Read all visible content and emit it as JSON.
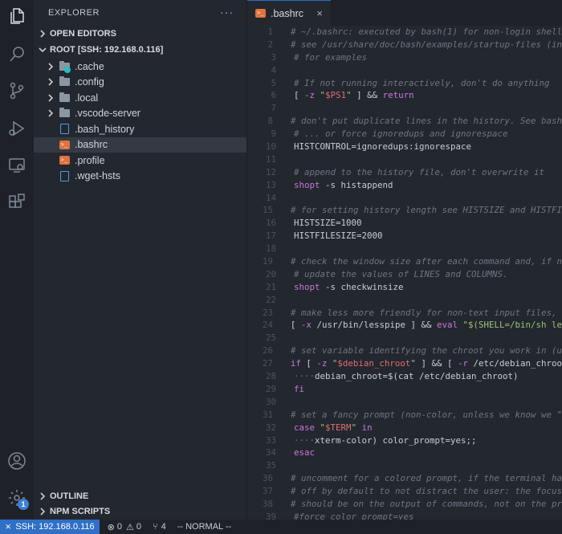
{
  "sidebar": {
    "title": "EXPLORER",
    "more": "···",
    "open_editors": "OPEN EDITORS",
    "root": "ROOT [SSH: 192.168.0.116]",
    "items": [
      {
        "label": ".cache",
        "type": "folder"
      },
      {
        "label": ".config",
        "type": "folder"
      },
      {
        "label": ".local",
        "type": "folder"
      },
      {
        "label": ".vscode-server",
        "type": "folder"
      },
      {
        "label": ".bash_history",
        "type": "file"
      },
      {
        "label": ".bashrc",
        "type": "shell"
      },
      {
        "label": ".profile",
        "type": "shell"
      },
      {
        "label": ".wget-hsts",
        "type": "file"
      }
    ],
    "outline": "OUTLINE",
    "npm_scripts": "NPM SCRIPTS"
  },
  "activity": {
    "icons": [
      "files-icon",
      "search-icon",
      "source-control-icon",
      "run-debug-icon",
      "remote-explorer-icon",
      "extensions-icon",
      "account-icon",
      "settings-gear-icon"
    ],
    "settings_badge": "1"
  },
  "tab": {
    "label": ".bashrc",
    "close": "×"
  },
  "statusbar": {
    "remote": "SSH: 192.168.0.116",
    "errors": "0",
    "warnings": "0",
    "ports": "4",
    "mode": "-- NORMAL --"
  },
  "colors": {
    "accent": "#2f6fc5",
    "comment": "#6d7683",
    "keyword": "#c678dd",
    "string": "#98c379",
    "variable": "#e06c75"
  },
  "code": [
    {
      "n": "1",
      "t": [
        [
          "c",
          "# ~/.bashrc: executed by bash(1) for non-login shell"
        ]
      ]
    },
    {
      "n": "2",
      "t": [
        [
          "c",
          "# see /usr/share/doc/bash/examples/startup-files (in"
        ]
      ]
    },
    {
      "n": "3",
      "t": [
        [
          "c",
          "# for examples"
        ]
      ]
    },
    {
      "n": "4",
      "t": []
    },
    {
      "n": "5",
      "t": [
        [
          "c",
          "# If not running interactively, don't do anything"
        ]
      ]
    },
    {
      "n": "6",
      "t": [
        [
          "p",
          "[ "
        ],
        [
          "k",
          "-z"
        ],
        [
          "p",
          " "
        ],
        [
          "s",
          "\""
        ],
        [
          "v",
          "$PS1"
        ],
        [
          "s",
          "\""
        ],
        [
          "p",
          " ] && "
        ],
        [
          "k",
          "return"
        ]
      ]
    },
    {
      "n": "7",
      "t": []
    },
    {
      "n": "8",
      "t": [
        [
          "c",
          "# don't put duplicate lines in the history. See bash"
        ]
      ]
    },
    {
      "n": "9",
      "t": [
        [
          "c",
          "# ... or force ignoredups and ignorespace"
        ]
      ]
    },
    {
      "n": "10",
      "t": [
        [
          "p",
          "HISTCONTROL=ignoredups:ignorespace"
        ]
      ]
    },
    {
      "n": "11",
      "t": []
    },
    {
      "n": "12",
      "t": [
        [
          "c",
          "# append to the history file, don't overwrite it"
        ]
      ]
    },
    {
      "n": "13",
      "t": [
        [
          "k",
          "shopt"
        ],
        [
          "p",
          " -s histappend"
        ]
      ]
    },
    {
      "n": "14",
      "t": []
    },
    {
      "n": "15",
      "t": [
        [
          "c",
          "# for setting history length see HISTSIZE and HISTFI"
        ]
      ]
    },
    {
      "n": "16",
      "t": [
        [
          "p",
          "HISTSIZE=1000"
        ]
      ]
    },
    {
      "n": "17",
      "t": [
        [
          "p",
          "HISTFILESIZE=2000"
        ]
      ]
    },
    {
      "n": "18",
      "t": []
    },
    {
      "n": "19",
      "t": [
        [
          "c",
          "# check the window size after each command and, if n"
        ]
      ]
    },
    {
      "n": "20",
      "t": [
        [
          "c",
          "# update the values of LINES and COLUMNS."
        ]
      ]
    },
    {
      "n": "21",
      "t": [
        [
          "k",
          "shopt"
        ],
        [
          "p",
          " -s checkwinsize"
        ]
      ]
    },
    {
      "n": "22",
      "t": []
    },
    {
      "n": "23",
      "t": [
        [
          "c",
          "# make less more friendly for non-text input files, "
        ]
      ]
    },
    {
      "n": "24",
      "t": [
        [
          "p",
          "[ "
        ],
        [
          "k",
          "-x"
        ],
        [
          "p",
          " /usr/bin/lesspipe ] && "
        ],
        [
          "k",
          "eval"
        ],
        [
          "p",
          " "
        ],
        [
          "s",
          "\"$(SHELL=/bin/sh le"
        ]
      ]
    },
    {
      "n": "25",
      "t": []
    },
    {
      "n": "26",
      "t": [
        [
          "c",
          "# set variable identifying the chroot you work in (u"
        ]
      ]
    },
    {
      "n": "27",
      "t": [
        [
          "k",
          "if"
        ],
        [
          "p",
          " [ "
        ],
        [
          "k",
          "-z"
        ],
        [
          "p",
          " "
        ],
        [
          "s",
          "\""
        ],
        [
          "v",
          "$debian_chroot"
        ],
        [
          "s",
          "\""
        ],
        [
          "p",
          " ] && [ "
        ],
        [
          "k",
          "-r"
        ],
        [
          "p",
          " /etc/debian_chroo"
        ]
      ]
    },
    {
      "n": "28",
      "t": [
        [
          "c",
          "····"
        ],
        [
          "p",
          "debian_chroot=$(cat /etc/debian_chroot)"
        ]
      ]
    },
    {
      "n": "29",
      "t": [
        [
          "k",
          "fi"
        ]
      ]
    },
    {
      "n": "30",
      "t": []
    },
    {
      "n": "31",
      "t": [
        [
          "c",
          "# set a fancy prompt (non-color, unless we know we \""
        ]
      ]
    },
    {
      "n": "32",
      "t": [
        [
          "k",
          "case"
        ],
        [
          "p",
          " "
        ],
        [
          "s",
          "\""
        ],
        [
          "v",
          "$TERM"
        ],
        [
          "s",
          "\""
        ],
        [
          "p",
          " "
        ],
        [
          "k",
          "in"
        ]
      ]
    },
    {
      "n": "33",
      "t": [
        [
          "c",
          "····"
        ],
        [
          "p",
          "xterm-color) color_prompt=yes;;"
        ]
      ]
    },
    {
      "n": "34",
      "t": [
        [
          "k",
          "esac"
        ]
      ]
    },
    {
      "n": "35",
      "t": []
    },
    {
      "n": "36",
      "t": [
        [
          "c",
          "# uncomment for a colored prompt, if the terminal ha"
        ]
      ]
    },
    {
      "n": "37",
      "t": [
        [
          "c",
          "# off by default to not distract the user: the focus"
        ]
      ]
    },
    {
      "n": "38",
      "t": [
        [
          "c",
          "# should be on the output of commands, not on the pr"
        ]
      ]
    },
    {
      "n": "39",
      "t": [
        [
          "c",
          "#force_color_prompt=yes"
        ]
      ]
    }
  ]
}
